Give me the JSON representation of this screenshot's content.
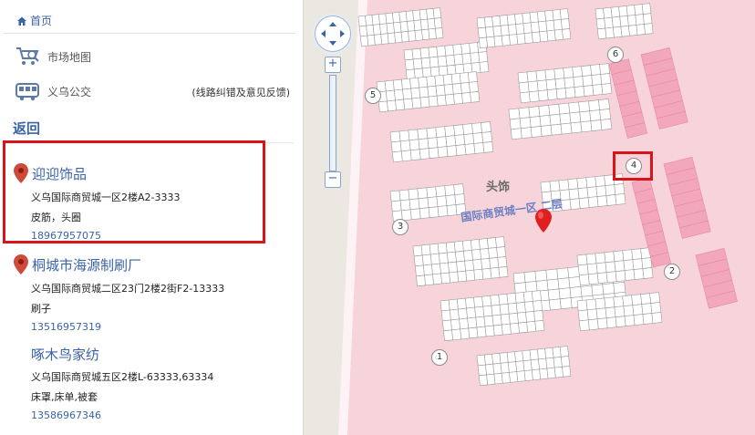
{
  "sidebar": {
    "home": "首页",
    "nav": [
      {
        "label": "市场地图",
        "icon": "cart-map-icon"
      },
      {
        "label": "义乌公交",
        "icon": "bus-icon"
      }
    ],
    "feedback": "(线路纠错及意见反馈)",
    "back": "返回",
    "shops": [
      {
        "name": "迎迎饰品",
        "address": "义乌国际商贸城一区2楼A2-3333",
        "goods": "皮筋，头圈",
        "phone": "18967957075"
      },
      {
        "name": "桐城市海源制刷厂",
        "address": "义乌国际商贸城二区23门2楼2街F2-13333",
        "goods": "刷子",
        "phone": "13516957319"
      },
      {
        "name": "啄木鸟家纺",
        "address": "义乌国际商贸城五区2楼L-63333,63334",
        "goods": "床罩,床单,被套",
        "phone": "13586967346"
      }
    ]
  },
  "map": {
    "zone_title": "头饰",
    "zone_subtitle": "国际商贸城一区  二层",
    "gates": [
      "1",
      "2",
      "3",
      "4",
      "5",
      "6"
    ],
    "zoom_in": "+",
    "zoom_out": "−",
    "colors": {
      "base": "#f7d3da",
      "grid": "#9a9a9a",
      "dark_block": "#f2a7bb",
      "highlight": "#d9131a",
      "link": "#3a63a8"
    }
  }
}
